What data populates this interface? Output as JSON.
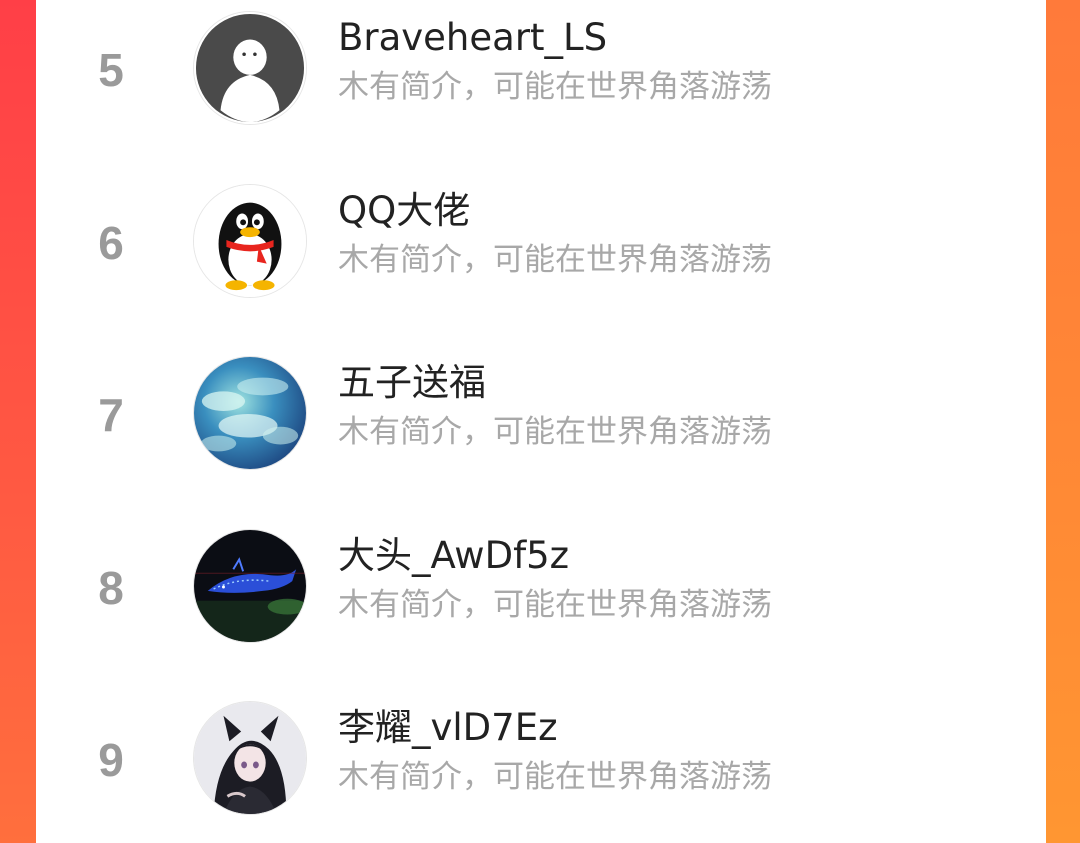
{
  "theme": {
    "accent_left": "#ff4a45",
    "accent_right": "#ff8a35",
    "rank_color": "#9a9a9a",
    "name_color": "#222222",
    "bio_color": "#a8a8a8"
  },
  "users": [
    {
      "rank": "5",
      "name": "Braveheart_LS",
      "bio": "木有简介，可能在世界角落游荡",
      "avatar": "default-person-avatar"
    },
    {
      "rank": "6",
      "name": "QQ大佬",
      "bio": "木有简介，可能在世界角落游荡",
      "avatar": "penguin-avatar"
    },
    {
      "rank": "7",
      "name": "五子送福",
      "bio": "木有简介，可能在世界角落游荡",
      "avatar": "blue-clouds-avatar"
    },
    {
      "rank": "8",
      "name": "大头_AwDf5z",
      "bio": "木有简介，可能在世界角落游荡",
      "avatar": "night-whale-lights-avatar"
    },
    {
      "rank": "9",
      "name": "李耀_vlD7Ez",
      "bio": "木有简介，可能在世界角落游荡",
      "avatar": "anime-character-avatar"
    }
  ]
}
